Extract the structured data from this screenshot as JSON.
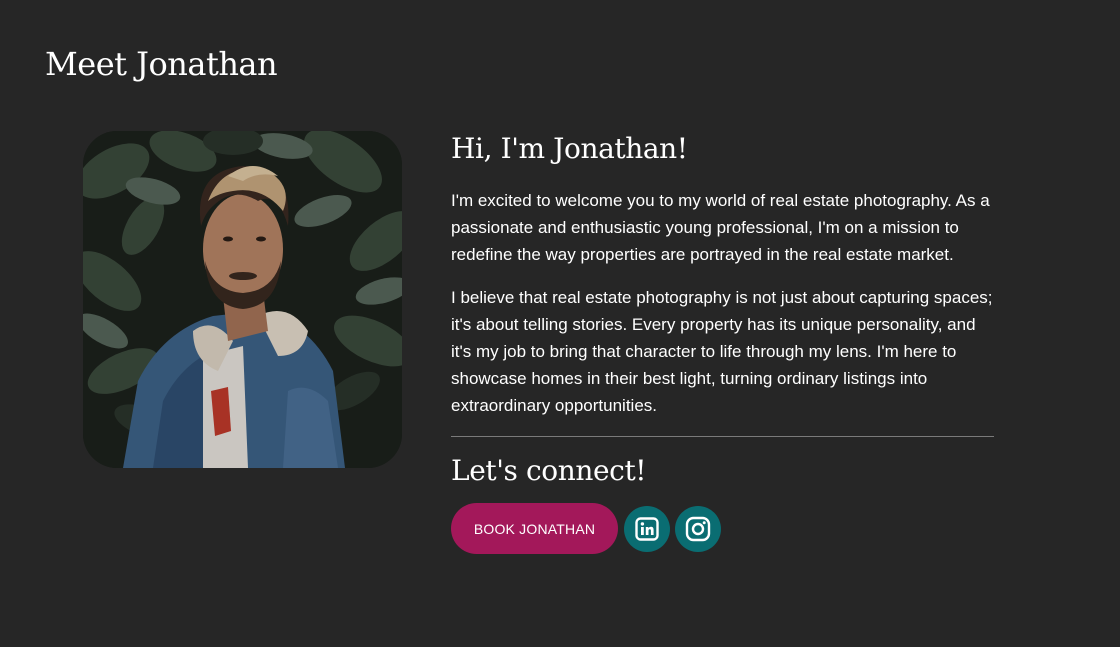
{
  "section": {
    "title": "Meet Jonathan"
  },
  "profile": {
    "greeting": "Hi, I'm Jonathan!",
    "paragraphs": [
      "I'm excited to welcome you to my world of real estate photography. As a passionate and enthusiastic young professional, I'm on a mission to redefine the way properties are portrayed in the real estate market.",
      "I believe that real estate photography is not just about capturing spaces; it's about telling stories. Every property has its unique personality, and it's my job to bring that character to life through my lens. I'm here to showcase homes in their best light, turning ordinary listings into extraordinary opportunities."
    ]
  },
  "connect": {
    "heading": "Let's connect!",
    "book_label": "BOOK JONATHAN",
    "socials": [
      {
        "icon": "linkedin-icon"
      },
      {
        "icon": "instagram-icon"
      }
    ]
  },
  "colors": {
    "background": "#262626",
    "book_button": "#a3185a",
    "social_button": "#0a6d72",
    "text": "#ffffff"
  }
}
